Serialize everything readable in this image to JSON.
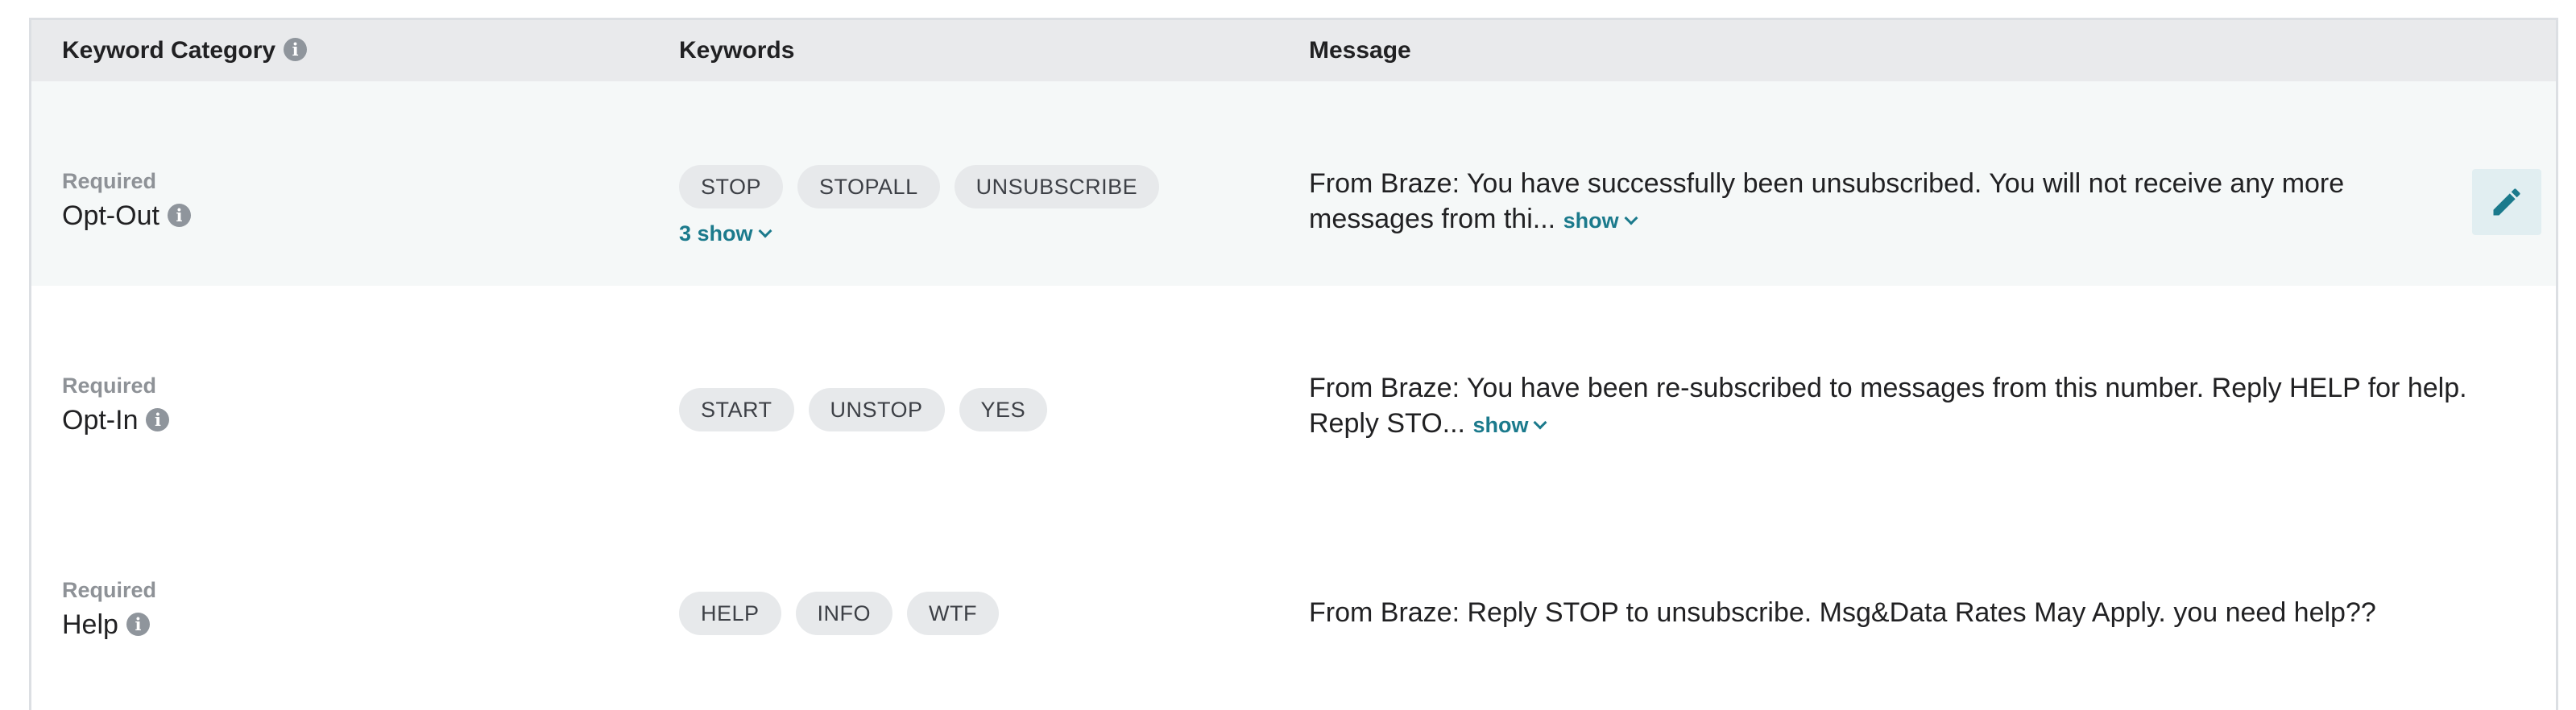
{
  "header": {
    "col_category": "Keyword Category",
    "col_keywords": "Keywords",
    "col_message": "Message"
  },
  "rows": [
    {
      "required": "Required",
      "category": "Opt-Out",
      "keywords": [
        "STOP",
        "STOPALL",
        "UNSUBSCRIBE"
      ],
      "more_keywords": "3 show",
      "message": "From Braze: You have successfully been unsubscribed. You will not receive any more messages from thi...",
      "message_show": "show"
    },
    {
      "required": "Required",
      "category": "Opt-In",
      "keywords": [
        "START",
        "UNSTOP",
        "YES"
      ],
      "message": "From Braze: You have been re-subscribed to messages from this number. Reply HELP for help. Reply STO...",
      "message_show": "show"
    },
    {
      "required": "Required",
      "category": "Help",
      "keywords": [
        "HELP",
        "INFO",
        "WTF"
      ],
      "message": "From Braze: Reply STOP to unsubscribe. Msg&Data Rates May Apply. you need help??"
    }
  ],
  "icons": {
    "info": "info-icon",
    "edit": "pencil-icon",
    "expand": "chevron-down-icon"
  },
  "colors": {
    "header_bg": "#e9eaec",
    "row_highlight_bg": "#f5f8f8",
    "link_teal": "#1b7a8c",
    "chip_bg": "#e7e9eb",
    "edit_button_bg": "#e1eef1"
  }
}
